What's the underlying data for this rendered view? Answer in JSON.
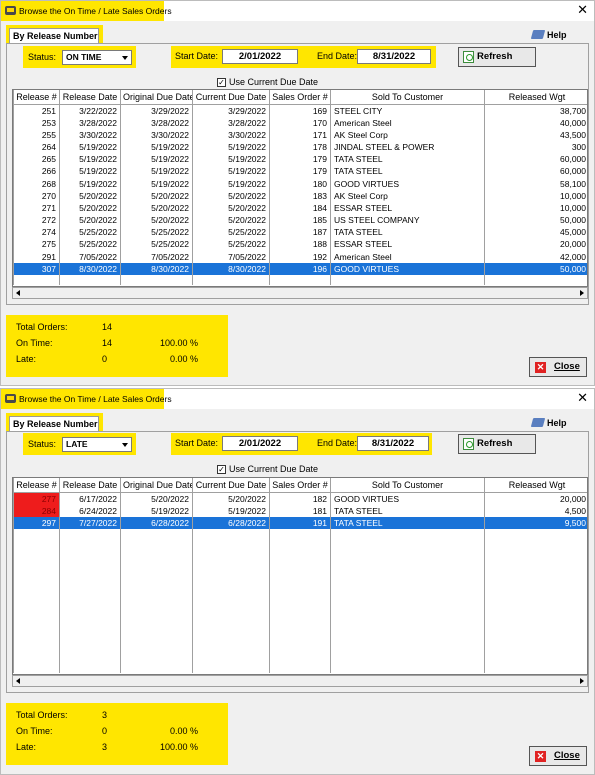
{
  "windows": [
    {
      "title": "Browse the On Time / Late Sales Orders",
      "tab": "By Release Number",
      "help_label": "Help",
      "status_label": "Status:",
      "status_value": "ON TIME",
      "start_date_label": "Start Date:",
      "start_date": "2/01/2022",
      "end_date_label": "End Date:",
      "end_date": "8/31/2022",
      "refresh_label": "Refresh",
      "use_current_due_label": "Use Current Due Date",
      "use_current_due_checked": "✓",
      "columns": [
        "Release #",
        "Release Date",
        "Original Due Date",
        "Current Due Date",
        "Sales Order #",
        "Sold To Customer",
        "Released Wgt"
      ],
      "rows": [
        [
          "251",
          "3/22/2022",
          "3/29/2022",
          "3/29/2022",
          "169",
          "STEEL CITY",
          "38,700"
        ],
        [
          "253",
          "3/28/2022",
          "3/28/2022",
          "3/28/2022",
          "170",
          "American Steel",
          "40,000"
        ],
        [
          "255",
          "3/30/2022",
          "3/30/2022",
          "3/30/2022",
          "171",
          "AK Steel Corp",
          "43,500"
        ],
        [
          "264",
          "5/19/2022",
          "5/19/2022",
          "5/19/2022",
          "178",
          "JINDAL STEEL & POWER",
          "300"
        ],
        [
          "265",
          "5/19/2022",
          "5/19/2022",
          "5/19/2022",
          "179",
          "TATA STEEL",
          "60,000"
        ],
        [
          "266",
          "5/19/2022",
          "5/19/2022",
          "5/19/2022",
          "179",
          "TATA STEEL",
          "60,000"
        ],
        [
          "268",
          "5/19/2022",
          "5/19/2022",
          "5/19/2022",
          "180",
          "GOOD VIRTUES",
          "58,100"
        ],
        [
          "270",
          "5/20/2022",
          "5/20/2022",
          "5/20/2022",
          "183",
          "AK Steel Corp",
          "10,000"
        ],
        [
          "271",
          "5/20/2022",
          "5/20/2022",
          "5/20/2022",
          "184",
          "ESSAR STEEL",
          "10,000"
        ],
        [
          "272",
          "5/20/2022",
          "5/20/2022",
          "5/20/2022",
          "185",
          "US STEEL COMPANY",
          "50,000"
        ],
        [
          "274",
          "5/25/2022",
          "5/25/2022",
          "5/25/2022",
          "187",
          "TATA STEEL",
          "45,000"
        ],
        [
          "275",
          "5/25/2022",
          "5/25/2022",
          "5/25/2022",
          "188",
          "ESSAR STEEL",
          "20,000"
        ],
        [
          "291",
          "7/05/2022",
          "7/05/2022",
          "7/05/2022",
          "192",
          "American Steel",
          "42,000"
        ],
        [
          "307",
          "8/30/2022",
          "8/30/2022",
          "8/30/2022",
          "196",
          "GOOD VIRTUES",
          "50,000"
        ]
      ],
      "selected_row": 13,
      "red_rows": [],
      "summary": {
        "total_label": "Total Orders:",
        "total": "14",
        "ontime_label": "On Time:",
        "ontime": "14",
        "ontime_pct": "100.00 %",
        "late_label": "Late:",
        "late": "0",
        "late_pct": "0.00 %"
      },
      "close_label": "Close"
    },
    {
      "title": "Browse the On Time / Late Sales Orders",
      "tab": "By Release Number",
      "help_label": "Help",
      "status_label": "Status:",
      "status_value": "LATE",
      "start_date_label": "Start Date:",
      "start_date": "2/01/2022",
      "end_date_label": "End Date:",
      "end_date": "8/31/2022",
      "refresh_label": "Refresh",
      "use_current_due_label": "Use Current Due Date",
      "use_current_due_checked": "✓",
      "columns": [
        "Release #",
        "Release Date",
        "Original Due Date",
        "Current Due Date",
        "Sales Order #",
        "Sold To Customer",
        "Released Wgt"
      ],
      "rows": [
        [
          "277",
          "6/17/2022",
          "5/20/2022",
          "5/20/2022",
          "182",
          "GOOD VIRTUES",
          "20,000"
        ],
        [
          "284",
          "6/24/2022",
          "5/19/2022",
          "5/19/2022",
          "181",
          "TATA STEEL",
          "4,500"
        ],
        [
          "297",
          "7/27/2022",
          "6/28/2022",
          "6/28/2022",
          "191",
          "TATA STEEL",
          "9,500"
        ]
      ],
      "selected_row": 2,
      "red_rows": [
        0,
        1
      ],
      "summary": {
        "total_label": "Total Orders:",
        "total": "3",
        "ontime_label": "On Time:",
        "ontime": "0",
        "ontime_pct": "0.00 %",
        "late_label": "Late:",
        "late": "3",
        "late_pct": "100.00 %"
      },
      "close_label": "Close"
    }
  ],
  "colors": {
    "highlight": "#ffe600",
    "selection": "#1a73d8",
    "late_flag": "#ee1c1c"
  },
  "icons": [
    "app-icon",
    "close-icon",
    "help-icon",
    "refresh-icon",
    "close-button-icon"
  ]
}
